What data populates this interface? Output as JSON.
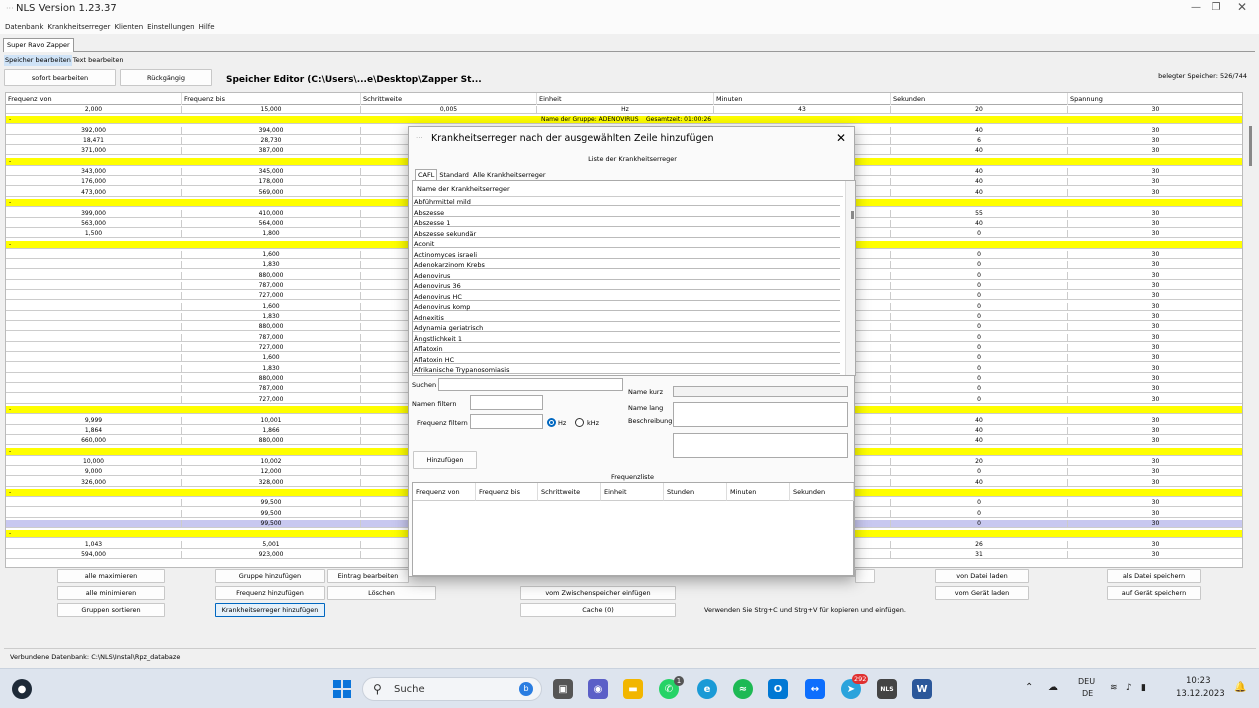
{
  "window": {
    "title": "NLS Version 1.23.37"
  },
  "menu": [
    "Datenbank",
    "Krankheitserreger",
    "Klienten",
    "Einstellungen",
    "Hilfe"
  ],
  "tab": "Super Ravo Zapper",
  "subtabs": [
    "Speicher bearbeiten",
    "Text bearbeiten"
  ],
  "toolbar": {
    "edit_now": "sofort bearbeiten",
    "undo": "Rückgängig"
  },
  "editor_title": "Speicher Editor (C:\\Users\\...e\\Desktop\\Zapper St...",
  "memory_used": "belegter Speicher: 526/744",
  "grid": {
    "columns": [
      "Frequenz von",
      "Frequenz bis",
      "Schrittweite",
      "Einheit",
      "Minuten",
      "Sekunden",
      "Spannung"
    ],
    "group_row": {
      "marker": "-",
      "name_prefix": "Name der Gruppe: ADENOVIRUS",
      "total_time": "Gesamtzeit: 01:00:26"
    },
    "rows": [
      {
        "t": "r",
        "c": [
          "2,000",
          "15,000",
          "0,005",
          "Hz",
          "43",
          "20",
          "30"
        ]
      },
      {
        "t": "g"
      },
      {
        "t": "r",
        "c": [
          "392,000",
          "394,000",
          "",
          "",
          "",
          "40",
          "30"
        ]
      },
      {
        "t": "r",
        "c": [
          "18,471",
          "28,730",
          "",
          "",
          "",
          "6",
          "30"
        ]
      },
      {
        "t": "r",
        "c": [
          "371,000",
          "387,000",
          "",
          "",
          "",
          "40",
          "30"
        ]
      },
      {
        "t": "g"
      },
      {
        "t": "r",
        "c": [
          "343,000",
          "345,000",
          "",
          "",
          "",
          "40",
          "30"
        ]
      },
      {
        "t": "r",
        "c": [
          "176,000",
          "178,000",
          "",
          "",
          "",
          "40",
          "30"
        ]
      },
      {
        "t": "r",
        "c": [
          "473,000",
          "569,000",
          "",
          "",
          "",
          "40",
          "30"
        ]
      },
      {
        "t": "g"
      },
      {
        "t": "r",
        "c": [
          "399,000",
          "410,000",
          "",
          "",
          "",
          "55",
          "30"
        ]
      },
      {
        "t": "r",
        "c": [
          "563,000",
          "564,000",
          "",
          "",
          "",
          "40",
          "30"
        ]
      },
      {
        "t": "r",
        "c": [
          "1,500",
          "1,800",
          "",
          "",
          "",
          "0",
          "30"
        ]
      },
      {
        "t": "g"
      },
      {
        "t": "r",
        "c": [
          "",
          "1,600",
          "",
          "",
          "",
          "0",
          "30"
        ]
      },
      {
        "t": "r",
        "c": [
          "",
          "1,830",
          "",
          "",
          "",
          "0",
          "30"
        ]
      },
      {
        "t": "r",
        "c": [
          "",
          "880,000",
          "",
          "",
          "",
          "0",
          "30"
        ]
      },
      {
        "t": "r",
        "c": [
          "",
          "787,000",
          "",
          "",
          "",
          "0",
          "30"
        ]
      },
      {
        "t": "r",
        "c": [
          "",
          "727,000",
          "",
          "",
          "",
          "0",
          "30"
        ]
      },
      {
        "t": "r",
        "c": [
          "",
          "1,600",
          "",
          "",
          "",
          "0",
          "30"
        ]
      },
      {
        "t": "r",
        "c": [
          "",
          "1,830",
          "",
          "",
          "",
          "0",
          "30"
        ]
      },
      {
        "t": "r",
        "c": [
          "",
          "880,000",
          "",
          "",
          "",
          "0",
          "30"
        ]
      },
      {
        "t": "r",
        "c": [
          "",
          "787,000",
          "",
          "",
          "",
          "0",
          "30"
        ]
      },
      {
        "t": "r",
        "c": [
          "",
          "727,000",
          "",
          "",
          "",
          "0",
          "30"
        ]
      },
      {
        "t": "r",
        "c": [
          "",
          "1,600",
          "",
          "",
          "",
          "0",
          "30"
        ]
      },
      {
        "t": "r",
        "c": [
          "",
          "1,830",
          "",
          "",
          "",
          "0",
          "30"
        ]
      },
      {
        "t": "r",
        "c": [
          "",
          "880,000",
          "",
          "",
          "",
          "0",
          "30"
        ]
      },
      {
        "t": "r",
        "c": [
          "",
          "787,000",
          "",
          "",
          "",
          "0",
          "30"
        ]
      },
      {
        "t": "r",
        "c": [
          "",
          "727,000",
          "",
          "",
          "",
          "0",
          "30"
        ]
      },
      {
        "t": "g"
      },
      {
        "t": "r",
        "c": [
          "9,999",
          "10,001",
          "",
          "",
          "",
          "40",
          "30"
        ]
      },
      {
        "t": "r",
        "c": [
          "1,864",
          "1,866",
          "",
          "",
          "",
          "40",
          "30"
        ]
      },
      {
        "t": "r",
        "c": [
          "660,000",
          "880,000",
          "",
          "",
          "",
          "40",
          "30"
        ]
      },
      {
        "t": "g"
      },
      {
        "t": "r",
        "c": [
          "10,000",
          "10,002",
          "",
          "",
          "",
          "20",
          "30"
        ]
      },
      {
        "t": "r",
        "c": [
          "9,000",
          "12,000",
          "",
          "",
          "",
          "0",
          "30"
        ]
      },
      {
        "t": "r",
        "c": [
          "326,000",
          "328,000",
          "",
          "",
          "",
          "40",
          "30"
        ]
      },
      {
        "t": "g"
      },
      {
        "t": "r",
        "c": [
          "",
          "99,500",
          "",
          "",
          "",
          "0",
          "30"
        ]
      },
      {
        "t": "r",
        "c": [
          "",
          "99,500",
          "",
          "",
          "",
          "0",
          "30"
        ]
      },
      {
        "t": "s",
        "c": [
          "",
          "99,500",
          "",
          "",
          "",
          "0",
          "30"
        ]
      },
      {
        "t": "g"
      },
      {
        "t": "r",
        "c": [
          "1,043",
          "5,001",
          "",
          "",
          "",
          "26",
          "30"
        ]
      },
      {
        "t": "r",
        "c": [
          "594,000",
          "923,000",
          "",
          "",
          "",
          "31",
          "30"
        ]
      }
    ]
  },
  "buttons": {
    "max_all": "alle maximieren",
    "min_all": "alle minimieren",
    "sort_groups": "Gruppen sortieren",
    "add_group": "Gruppe hinzufügen",
    "add_freq": "Frequenz hinzufügen",
    "add_pathogen": "Krankheitserreger hinzufügen",
    "edit_entry": "Eintrag bearbeiten",
    "delete": "Löschen",
    "paste_clip": "vom Zwischenspeicher einfügen",
    "cache": "Cache (0)",
    "load_file": "von Datei laden",
    "load_device": "vom Gerät laden",
    "save_file": "als Datei speichern",
    "save_device": "auf Gerät speichern"
  },
  "hint": "Verwenden Sie Strg+C und Strg+V für kopieren und einfügen.",
  "status": "Verbundene Datenbank: C:\\NLS\\Instal\\Rpz_databaze",
  "dialog": {
    "title": "Krankheitserreger nach der ausgewählten Zeile hinzufügen",
    "list_label": "Liste der Krankheitserreger",
    "tabs": [
      "CAFL",
      "Standard",
      "Alle Krankheitserreger"
    ],
    "list_header": "Name der Krankheitserreger",
    "items": [
      "Abführmittel mild",
      "Abszesse",
      "Abszesse 1",
      "Abszesse sekundär",
      "Aconit",
      "Actinomyces israeli",
      "Adenokarzinom Krebs",
      "Adenovirus",
      "Adenovirus 36",
      "Adenovirus HC",
      "Adenovirus komp",
      "Adnexitis",
      "Adynamia geriatrisch",
      "Ängstlichkeit 1",
      "Aflatoxin",
      "Aflatoxin HC",
      "Afrikanische Trypanosomiasis"
    ],
    "search_label": "Suchen",
    "filter_name_label": "Namen filtern",
    "filter_freq_label": "Frequenz filtern",
    "unit_hz": "Hz",
    "unit_khz": "kHz",
    "short_name_label": "Name kurz",
    "long_name_label": "Name lang",
    "description_label": "Beschreibung",
    "add_button": "Hinzufügen",
    "freq_list_label": "Frequenzliste",
    "freq_columns": [
      "Frequenz von",
      "Frequenz bis",
      "Schrittweite",
      "Einheit",
      "Stunden",
      "Minuten",
      "Sekunden"
    ]
  },
  "taskbar": {
    "search": "Suche",
    "lang1": "DEU",
    "lang2": "DE",
    "time": "10:23",
    "date": "13.12.2023",
    "badge_whatsapp": "1",
    "badge_mail": "292"
  }
}
